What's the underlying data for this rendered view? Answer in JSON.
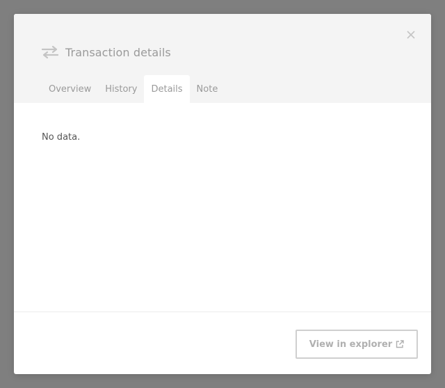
{
  "modal": {
    "title": "Transaction details",
    "title_icon": "transfer-arrows-icon",
    "close_icon": "close-icon"
  },
  "tabs": [
    {
      "label": "Overview",
      "active": false
    },
    {
      "label": "History",
      "active": false
    },
    {
      "label": "Details",
      "active": true
    },
    {
      "label": "Note",
      "active": false
    }
  ],
  "content": {
    "message": "No data."
  },
  "footer": {
    "explorer_label": "View in explorer",
    "explorer_icon": "external-link-icon"
  },
  "colors": {
    "overlay": "#7f7f7f",
    "header_bg": "#f4f4f4",
    "muted_text": "#9a9a9a",
    "button_border": "#cfcfcf"
  }
}
